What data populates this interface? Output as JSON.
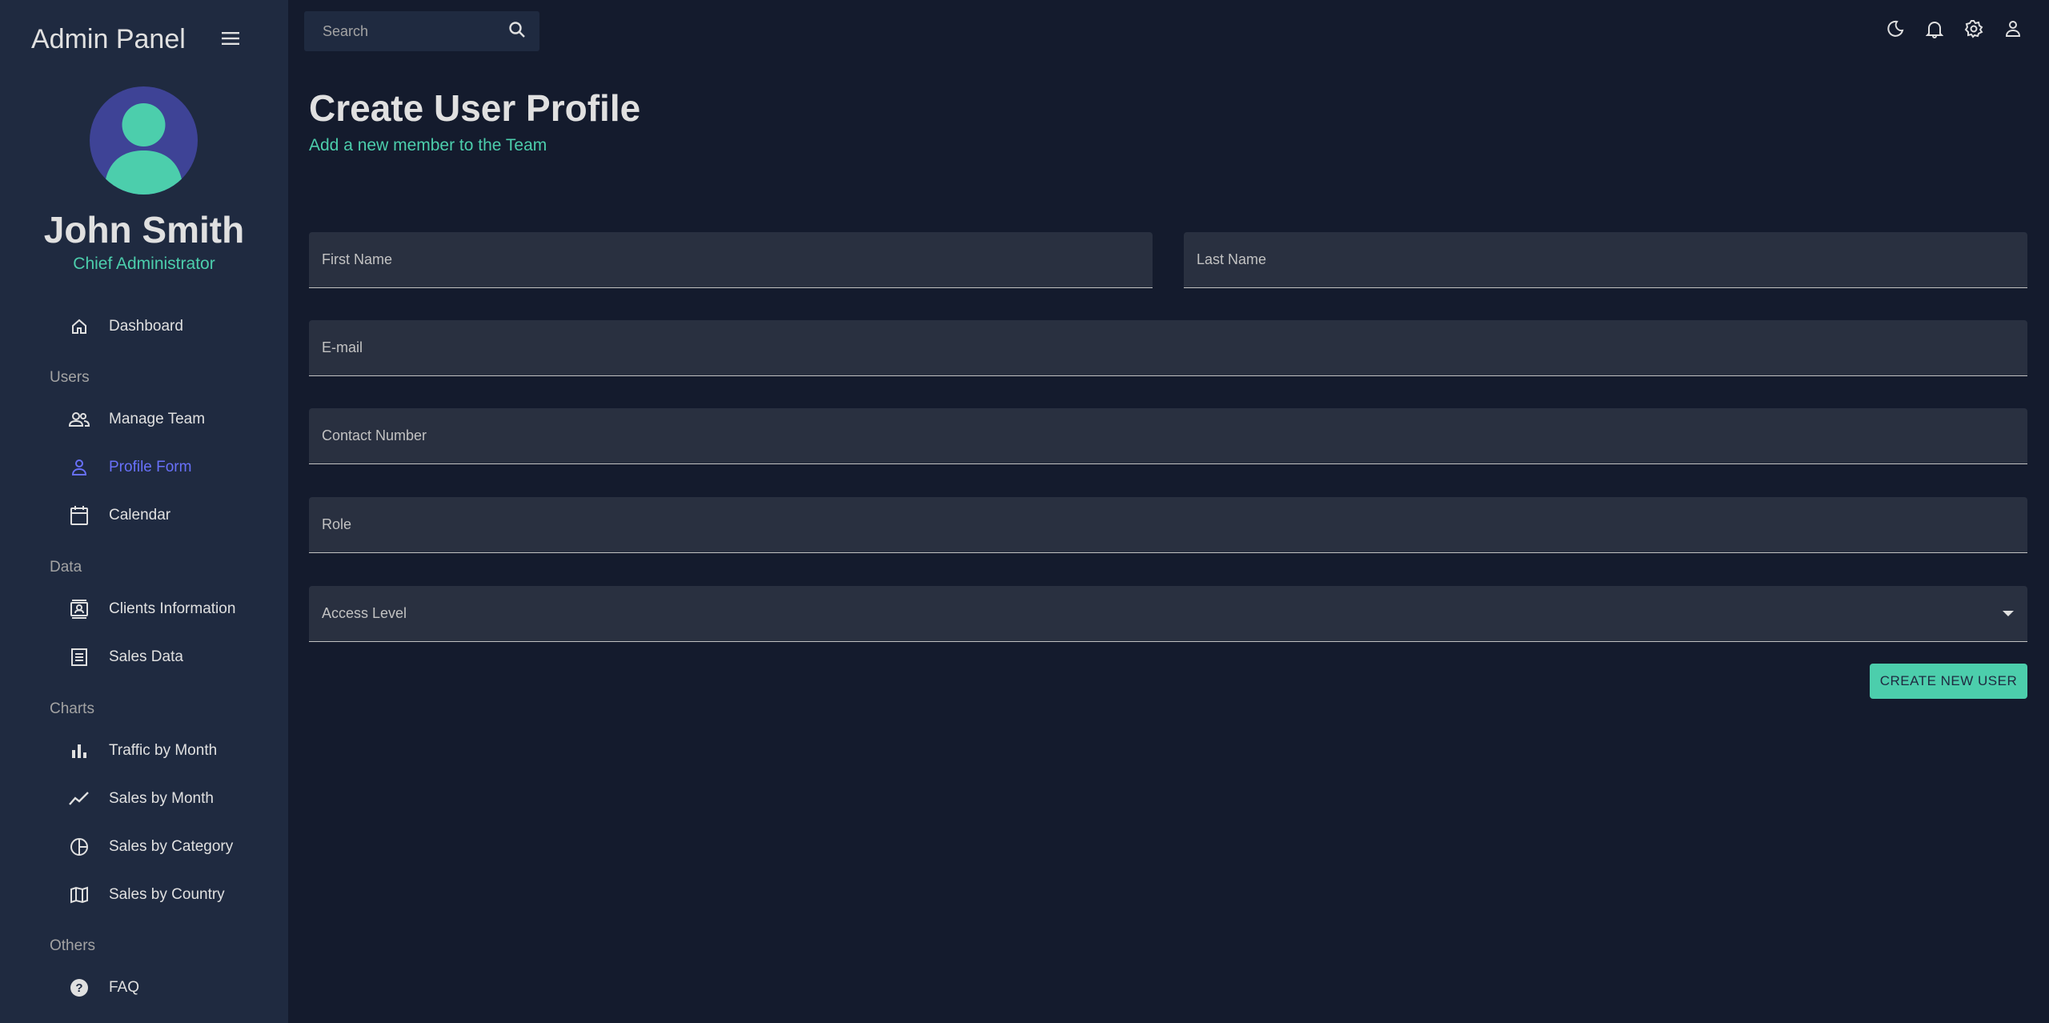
{
  "app": {
    "title": "Admin Panel"
  },
  "profile": {
    "name": "John Smith",
    "role": "Chief Administrator"
  },
  "nav": {
    "dashboard": "Dashboard",
    "sections": {
      "users": "Users",
      "data": "Data",
      "charts": "Charts",
      "others": "Others"
    },
    "items": [
      {
        "label": "Manage Team",
        "icon": "people-icon"
      },
      {
        "label": "Profile Form",
        "icon": "person-icon",
        "active": true
      },
      {
        "label": "Calendar",
        "icon": "calendar-icon"
      },
      {
        "label": "Clients Information",
        "icon": "contacts-icon"
      },
      {
        "label": "Sales Data",
        "icon": "receipt-icon"
      },
      {
        "label": "Traffic by Month",
        "icon": "bar-chart-icon"
      },
      {
        "label": "Sales by Month",
        "icon": "line-chart-icon"
      },
      {
        "label": "Sales by Category",
        "icon": "pie-chart-icon"
      },
      {
        "label": "Sales by Country",
        "icon": "map-icon"
      },
      {
        "label": "FAQ",
        "icon": "help-icon"
      }
    ]
  },
  "topbar": {
    "search_placeholder": "Search",
    "icons": [
      "dark-mode-icon",
      "notifications-icon",
      "settings-icon",
      "account-icon"
    ]
  },
  "page": {
    "title": "Create User Profile",
    "subtitle": "Add a new member to the Team"
  },
  "form": {
    "first_name_placeholder": "First Name",
    "last_name_placeholder": "Last Name",
    "email_placeholder": "E-mail",
    "contact_placeholder": "Contact Number",
    "role_placeholder": "Role",
    "access_level_label": "Access Level",
    "submit_label": "CREATE NEW USER"
  },
  "colors": {
    "background": "#141b2d",
    "sidebar": "#1f2a40",
    "accent": "#4cceac",
    "active_nav": "#6870fa",
    "avatar_bg": "#3e4396"
  }
}
